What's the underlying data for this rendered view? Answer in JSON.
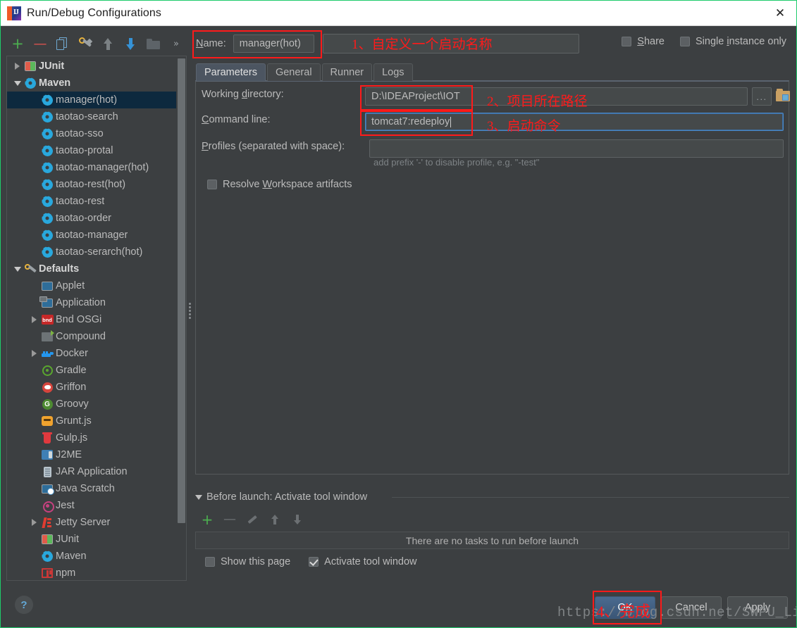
{
  "window": {
    "title": "Run/Debug Configurations",
    "close_label": "✕",
    "app_icon": "IJ"
  },
  "left_toolbar": {
    "buttons": [
      {
        "name": "add-configuration-button",
        "icon": "plus-icon",
        "label": "+"
      },
      {
        "name": "remove-configuration-button",
        "icon": "minus-icon",
        "label": "−"
      },
      {
        "name": "copy-configuration-button",
        "icon": "copy-icon",
        "label": ""
      },
      {
        "name": "edit-defaults-button",
        "icon": "wrench-icon",
        "label": ""
      },
      {
        "name": "move-up-button",
        "icon": "arrow-up-icon",
        "label": ""
      },
      {
        "name": "move-down-button",
        "icon": "arrow-down-icon",
        "label": ""
      },
      {
        "name": "folder-button",
        "icon": "folder-icon",
        "label": ""
      },
      {
        "name": "more-options-button",
        "icon": "chevron-double-right-icon",
        "label": "»"
      }
    ]
  },
  "tree": {
    "items": [
      {
        "label": "JUnit",
        "icon": "junit-icon",
        "indent": 0,
        "twisty": "collapsed",
        "bold": true,
        "selected": false
      },
      {
        "label": "Maven",
        "icon": "maven-gear-icon",
        "indent": 0,
        "twisty": "expanded",
        "bold": true,
        "selected": false
      },
      {
        "label": "manager(hot)",
        "icon": "maven-gear-icon",
        "indent": 1,
        "twisty": "none",
        "bold": false,
        "selected": true
      },
      {
        "label": "taotao-search",
        "icon": "maven-gear-icon",
        "indent": 1,
        "twisty": "none",
        "bold": false,
        "selected": false
      },
      {
        "label": "taotao-sso",
        "icon": "maven-gear-icon",
        "indent": 1,
        "twisty": "none",
        "bold": false,
        "selected": false
      },
      {
        "label": "taotao-protal",
        "icon": "maven-gear-icon",
        "indent": 1,
        "twisty": "none",
        "bold": false,
        "selected": false
      },
      {
        "label": "taotao-manager(hot)",
        "icon": "maven-gear-icon",
        "indent": 1,
        "twisty": "none",
        "bold": false,
        "selected": false
      },
      {
        "label": "taotao-rest(hot)",
        "icon": "maven-gear-icon",
        "indent": 1,
        "twisty": "none",
        "bold": false,
        "selected": false
      },
      {
        "label": "taotao-rest",
        "icon": "maven-gear-icon",
        "indent": 1,
        "twisty": "none",
        "bold": false,
        "selected": false
      },
      {
        "label": "taotao-order",
        "icon": "maven-gear-icon",
        "indent": 1,
        "twisty": "none",
        "bold": false,
        "selected": false
      },
      {
        "label": "taotao-manager",
        "icon": "maven-gear-icon",
        "indent": 1,
        "twisty": "none",
        "bold": false,
        "selected": false
      },
      {
        "label": "taotao-serarch(hot)",
        "icon": "maven-gear-icon",
        "indent": 1,
        "twisty": "none",
        "bold": false,
        "selected": false
      },
      {
        "label": "Defaults",
        "icon": "wrench-icon",
        "indent": 0,
        "twisty": "expanded",
        "bold": true,
        "selected": false
      },
      {
        "label": "Applet",
        "icon": "applet-icon",
        "indent": 1,
        "twisty": "none",
        "bold": false,
        "selected": false
      },
      {
        "label": "Application",
        "icon": "application-icon",
        "indent": 1,
        "twisty": "none",
        "bold": false,
        "selected": false
      },
      {
        "label": "Bnd OSGi",
        "icon": "bnd-icon",
        "indent": 1,
        "twisty": "collapsed",
        "bold": false,
        "selected": false
      },
      {
        "label": "Compound",
        "icon": "compound-icon",
        "indent": 1,
        "twisty": "none",
        "bold": false,
        "selected": false
      },
      {
        "label": "Docker",
        "icon": "docker-icon",
        "indent": 1,
        "twisty": "collapsed",
        "bold": false,
        "selected": false
      },
      {
        "label": "Gradle",
        "icon": "gradle-icon",
        "indent": 1,
        "twisty": "none",
        "bold": false,
        "selected": false
      },
      {
        "label": "Griffon",
        "icon": "griffon-icon",
        "indent": 1,
        "twisty": "none",
        "bold": false,
        "selected": false
      },
      {
        "label": "Groovy",
        "icon": "groovy-icon",
        "indent": 1,
        "twisty": "none",
        "bold": false,
        "selected": false
      },
      {
        "label": "Grunt.js",
        "icon": "grunt-icon",
        "indent": 1,
        "twisty": "none",
        "bold": false,
        "selected": false
      },
      {
        "label": "Gulp.js",
        "icon": "gulp-icon",
        "indent": 1,
        "twisty": "none",
        "bold": false,
        "selected": false
      },
      {
        "label": "J2ME",
        "icon": "j2me-icon",
        "indent": 1,
        "twisty": "none",
        "bold": false,
        "selected": false
      },
      {
        "label": "JAR Application",
        "icon": "jar-icon",
        "indent": 1,
        "twisty": "none",
        "bold": false,
        "selected": false
      },
      {
        "label": "Java Scratch",
        "icon": "java-scratch-icon",
        "indent": 1,
        "twisty": "none",
        "bold": false,
        "selected": false
      },
      {
        "label": "Jest",
        "icon": "jest-icon",
        "indent": 1,
        "twisty": "none",
        "bold": false,
        "selected": false
      },
      {
        "label": "Jetty Server",
        "icon": "jetty-icon",
        "indent": 1,
        "twisty": "collapsed",
        "bold": false,
        "selected": false
      },
      {
        "label": "JUnit",
        "icon": "junit-icon",
        "indent": 1,
        "twisty": "none",
        "bold": false,
        "selected": false
      },
      {
        "label": "Maven",
        "icon": "maven-gear-icon",
        "indent": 1,
        "twisty": "none",
        "bold": false,
        "selected": false
      },
      {
        "label": "npm",
        "icon": "npm-icon",
        "indent": 1,
        "twisty": "none",
        "bold": false,
        "selected": false
      }
    ]
  },
  "help": {
    "label": "?"
  },
  "form": {
    "name_label": "Name:",
    "name_value": "manager(hot)",
    "share_label": "Share",
    "share_checked": false,
    "single_instance_label": "Single instance only",
    "single_instance_checked": false,
    "tabs": [
      {
        "label": "Parameters",
        "active": true
      },
      {
        "label": "General",
        "active": false
      },
      {
        "label": "Runner",
        "active": false
      },
      {
        "label": "Logs",
        "active": false
      }
    ],
    "working_directory_label": "Working directory:",
    "working_directory_value": "D:\\IDEAProject\\IOT",
    "command_line_label": "Command line:",
    "command_line_value": "tomcat7:redeploy",
    "profiles_label": "Profiles (separated with space):",
    "profiles_value": "",
    "profiles_hint": "add prefix '-' to disable profile, e.g. \"-test\"",
    "resolve_workspace_label": "Resolve Workspace artifacts",
    "resolve_workspace_checked": false,
    "browse_button_label": "...",
    "folder_button_name": "browse-folder-icon"
  },
  "before_launch": {
    "title": "Before launch: Activate tool window",
    "empty_message": "There are no tasks to run before launch",
    "toolbar": [
      {
        "name": "add-task-button",
        "icon": "plus-icon"
      },
      {
        "name": "remove-task-button",
        "icon": "minus-icon"
      },
      {
        "name": "edit-task-button",
        "icon": "pencil-icon"
      },
      {
        "name": "move-task-up-button",
        "icon": "arrow-up-icon"
      },
      {
        "name": "move-task-down-button",
        "icon": "arrow-down-icon"
      }
    ],
    "show_this_page_label": "Show this page",
    "show_this_page_checked": false,
    "activate_tool_window_label": "Activate tool window",
    "activate_tool_window_checked": true
  },
  "buttons": {
    "ok": "OK",
    "cancel": "Cancel",
    "apply": "Apply"
  },
  "annotations": {
    "color": "#ff1a1a",
    "step1": "1、自定义一个启动名称",
    "step2": "2、项目所在路径",
    "step3": "3、启动命令",
    "step4": "4、完成"
  },
  "watermark": {
    "text": "https://blog.csdn.net/SWPU_Lipan"
  }
}
